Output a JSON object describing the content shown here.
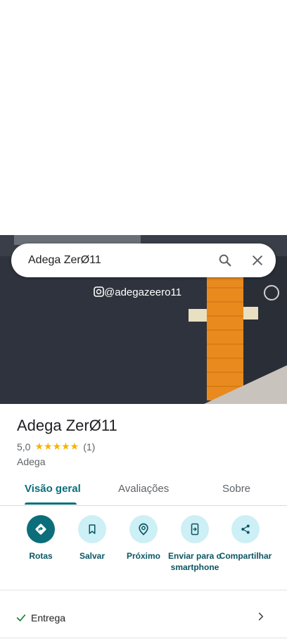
{
  "search": {
    "query": "Adega ZerØ11"
  },
  "photo": {
    "instagram_text": "@adegazeero11"
  },
  "place": {
    "name": "Adega ZerØ11",
    "rating": "5,0",
    "stars": "★★★★★",
    "review_count": "(1)",
    "category": "Adega"
  },
  "tabs": [
    {
      "label": "Visão geral",
      "active": true
    },
    {
      "label": "Avaliações"
    },
    {
      "label": "Sobre"
    }
  ],
  "actions": [
    {
      "label": "Rotas",
      "icon": "directions-icon"
    },
    {
      "label": "Salvar",
      "icon": "bookmark-icon"
    },
    {
      "label": "Próximo",
      "icon": "nearby-icon"
    },
    {
      "label": "Enviar para o smartphone",
      "icon": "send-to-phone-icon"
    },
    {
      "label": "Compartilhar",
      "icon": "share-icon"
    }
  ],
  "features": [
    {
      "label": "Entrega",
      "icon": "check-icon"
    }
  ],
  "colors": {
    "accent": "#0b6e7a",
    "action_bg": "#cdeff6",
    "star": "#f5b400"
  }
}
